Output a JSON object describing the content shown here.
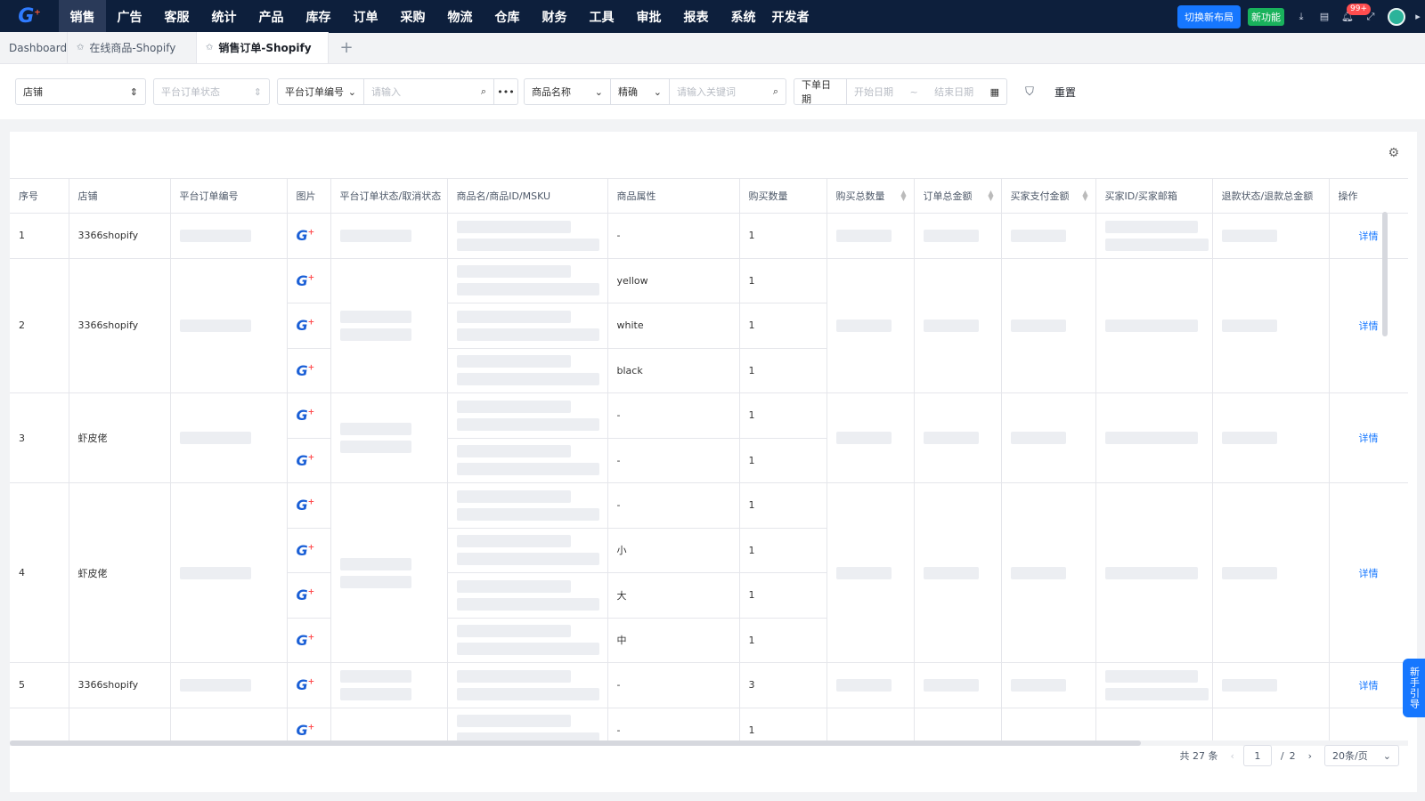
{
  "brand": {
    "logo": "G",
    "logo_mark": "+",
    "accent": "#1677ff",
    "nav_bg": "#0d1f3c"
  },
  "menu": [
    {
      "label": "销售"
    },
    {
      "label": "广告"
    },
    {
      "label": "客服"
    },
    {
      "label": "统计"
    },
    {
      "label": "产品"
    },
    {
      "label": "库存"
    },
    {
      "label": "订单"
    },
    {
      "label": "采购"
    },
    {
      "label": "物流"
    },
    {
      "label": "仓库"
    },
    {
      "label": "财务"
    },
    {
      "label": "工具"
    },
    {
      "label": "审批"
    },
    {
      "label": "报表"
    },
    {
      "label": "系统"
    },
    {
      "label": "开发者"
    }
  ],
  "nav_right": {
    "switch_layout": "切换新布局",
    "new_feature": "新功能",
    "badge": "99+",
    "icons": [
      "download-icon",
      "document-icon",
      "bell-icon",
      "fullscreen-icon",
      "avatar",
      "caret-right-icon"
    ]
  },
  "tabs": [
    {
      "label": "Dashboard"
    },
    {
      "label": "在线商品-Shopify"
    },
    {
      "label": "销售订单-Shopify"
    }
  ],
  "filters": {
    "shop": "店铺",
    "platform_status": "平台订单状态",
    "order_no_field": "平台订单编号",
    "order_no_placeholder": "请输入",
    "product_field": "商品名称",
    "match_mode": "精确",
    "keyword_placeholder": "请输入关键词",
    "date_label": "下单日期",
    "start_placeholder": "开始日期",
    "date_sep": "~",
    "end_placeholder": "结束日期",
    "reset": "重置"
  },
  "table": {
    "columns": [
      "序号",
      "店铺",
      "平台订单编号",
      "图片",
      "平台订单状态/取消状态",
      "商品名/商品ID/MSKU",
      "商品属性",
      "购买数量",
      "购买总数量",
      "订单总金额",
      "买家支付金额",
      "买家ID/买家邮箱",
      "退款状态/退款总金额",
      "操作"
    ],
    "orders": [
      {
        "seq": "1",
        "shop": "3366shopify",
        "items": [
          {
            "attr": "-",
            "qty": "1"
          }
        ],
        "action": "详情"
      },
      {
        "seq": "2",
        "shop": "3366shopify",
        "items": [
          {
            "attr": "yellow",
            "qty": "1"
          },
          {
            "attr": "white",
            "qty": "1"
          },
          {
            "attr": "black",
            "qty": "1"
          }
        ],
        "action": "详情"
      },
      {
        "seq": "3",
        "shop": "虾皮佬",
        "items": [
          {
            "attr": "-",
            "qty": "1"
          },
          {
            "attr": "-",
            "qty": "1"
          }
        ],
        "action": "详情"
      },
      {
        "seq": "4",
        "shop": "虾皮佬",
        "items": [
          {
            "attr": "-",
            "qty": "1"
          },
          {
            "attr": "小",
            "qty": "1"
          },
          {
            "attr": "大",
            "qty": "1"
          },
          {
            "attr": "中",
            "qty": "1"
          }
        ],
        "action": "详情"
      },
      {
        "seq": "5",
        "shop": "3366shopify",
        "items": [
          {
            "attr": "-",
            "qty": "3"
          }
        ],
        "action": "详情"
      },
      {
        "seq": "",
        "shop": "",
        "items": [
          {
            "attr": "-",
            "qty": "1"
          }
        ],
        "action": ""
      }
    ]
  },
  "pager": {
    "total": "共 27 条",
    "page": "1",
    "sep": "/",
    "pages": "2",
    "size": "20条/页"
  },
  "guide": "新手引导"
}
